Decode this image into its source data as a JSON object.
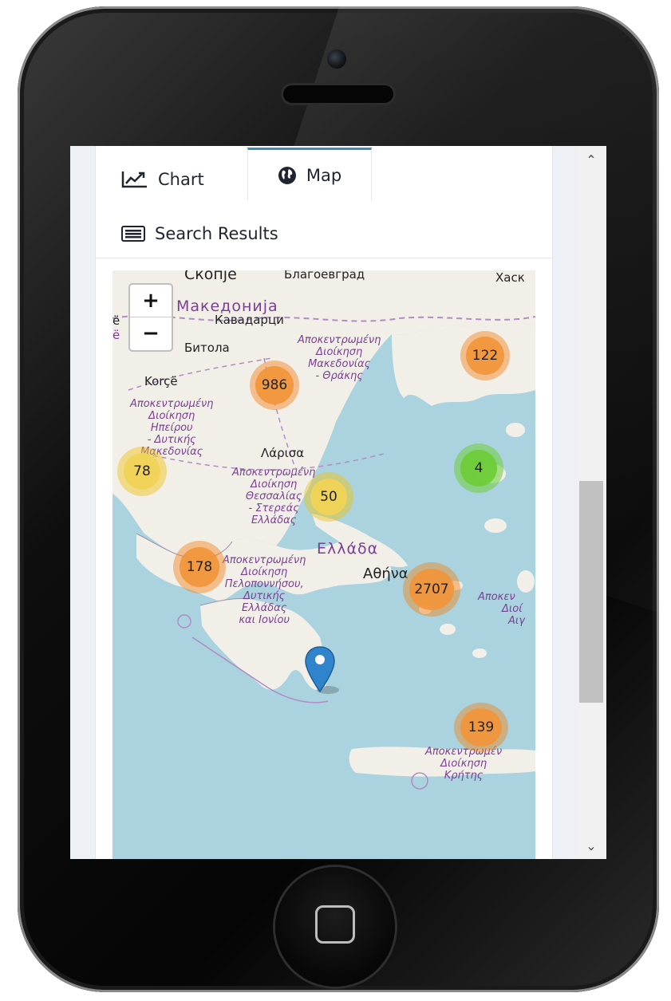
{
  "tabs": {
    "chart": "Chart",
    "map": "Map",
    "search_results": "Search Results",
    "active": "Map"
  },
  "map": {
    "zoom_in": "+",
    "zoom_out": "−",
    "clusters": [
      {
        "count": "122",
        "color": "orange"
      },
      {
        "count": "986",
        "color": "orange"
      },
      {
        "count": "78",
        "color": "yellow"
      },
      {
        "count": "4",
        "color": "green"
      },
      {
        "count": "50",
        "color": "yellow"
      },
      {
        "count": "178",
        "color": "orange"
      },
      {
        "count": "2707",
        "color": "orange"
      },
      {
        "count": "139",
        "color": "orange"
      }
    ],
    "labels": {
      "skopje": "Скопје",
      "blagoevgrad": "Благоевград",
      "hask": "Хаск",
      "makedonija": "Македонија",
      "kavadarci": "Кавадарци",
      "bitola": "Битола",
      "korce": "Korçë",
      "larisa": "Λάρισα",
      "ellada": "Ελλάδα",
      "athina": "Αθήνα",
      "e1": "ë",
      "e2": "ë",
      "amth_1": "Αποκεντρωμένη",
      "amth_2": "Διοίκηση",
      "amth_3": "Μακεδονίας",
      "amth_4": "- Θράκης",
      "ep_1": "Αποκεντρωμένη",
      "ep_2": "Διοίκηση",
      "ep_3": "Ηπείρου",
      "ep_4": "- Δυτικής",
      "ep_5": "Μακεδονίας",
      "th_1": "Αποκεντρωμένη",
      "th_2": "Διοίκηση",
      "th_3": "Θεσσαλίας",
      "th_4": "- Στερεάς",
      "th_5": "Ελλάδας",
      "pe_1": "Αποκεντρωμένη",
      "pe_2": "Διοίκηση",
      "pe_3": "Πελοποννήσου,",
      "pe_4": "Δυτικής",
      "pe_5": "Ελλάδας",
      "pe_6": "και Ιονίου",
      "ai_1": "Αποκεν",
      "ai_2": "Διοί",
      "ai_3": "Αιγ",
      "kr_1": "Αποκεντρωμέν",
      "kr_2": "Διοίκηση",
      "kr_3": "Κρήτης"
    }
  },
  "scrollbar": {
    "up": "⌃",
    "down": "⌄"
  }
}
